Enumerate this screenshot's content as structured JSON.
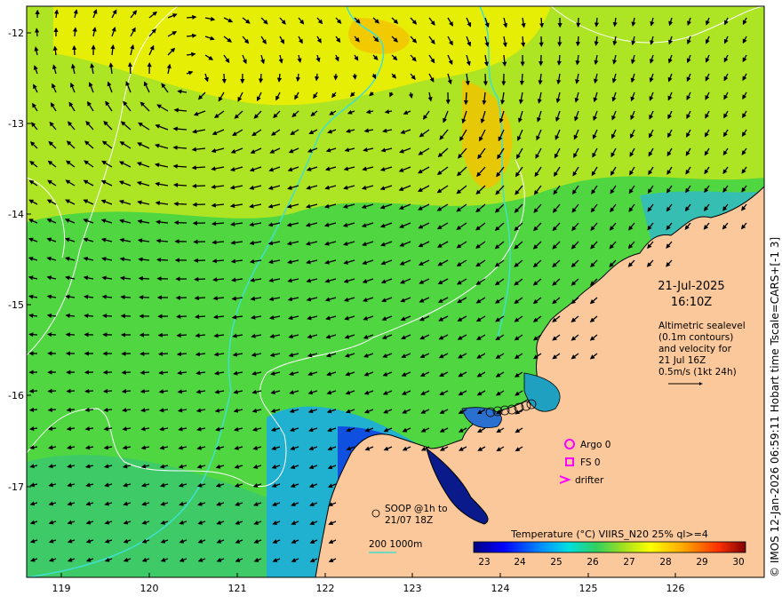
{
  "map": {
    "date": "21-Jul-2025",
    "time": "16:10Z",
    "lat_ticks": [
      "-12",
      "-13",
      "-14",
      "-15",
      "-16",
      "-17"
    ],
    "lon_ticks": [
      "119",
      "120",
      "121",
      "122",
      "123",
      "124",
      "125",
      "126"
    ],
    "altimetry_note": [
      "Altimetric sealevel",
      "(0.1m contours)",
      "and velocity for",
      "21 Jul 16Z",
      "0.5m/s (1kt 24h)"
    ],
    "argo_label": "Argo 0",
    "fs_label": "FS 0",
    "drifter_label": "drifter",
    "soop_note": [
      "SOOP @1h to",
      "21/07 18Z"
    ],
    "isobath_label": "200  1000m",
    "colorbar_title": "Temperature (°C) VIIRS_N20 25% ql>=4",
    "colorbar_ticks": [
      "23",
      "24",
      "25",
      "26",
      "27",
      "28",
      "29",
      "30"
    ],
    "side_credit": "© IMOS 12-Jan-2026 06:59:11 Hobart time Tscale=CARS+[-1 3]"
  },
  "colors": {
    "land": "#fac89a",
    "argo": "#ff00ff",
    "isobath_200": "#40e0d0",
    "contour": "#ffffff",
    "colormap": [
      "#00007f",
      "#0000ff",
      "#0090ff",
      "#00e0e0",
      "#30d060",
      "#a0e020",
      "#ffff00",
      "#ffa000",
      "#ff3000",
      "#800000"
    ]
  }
}
